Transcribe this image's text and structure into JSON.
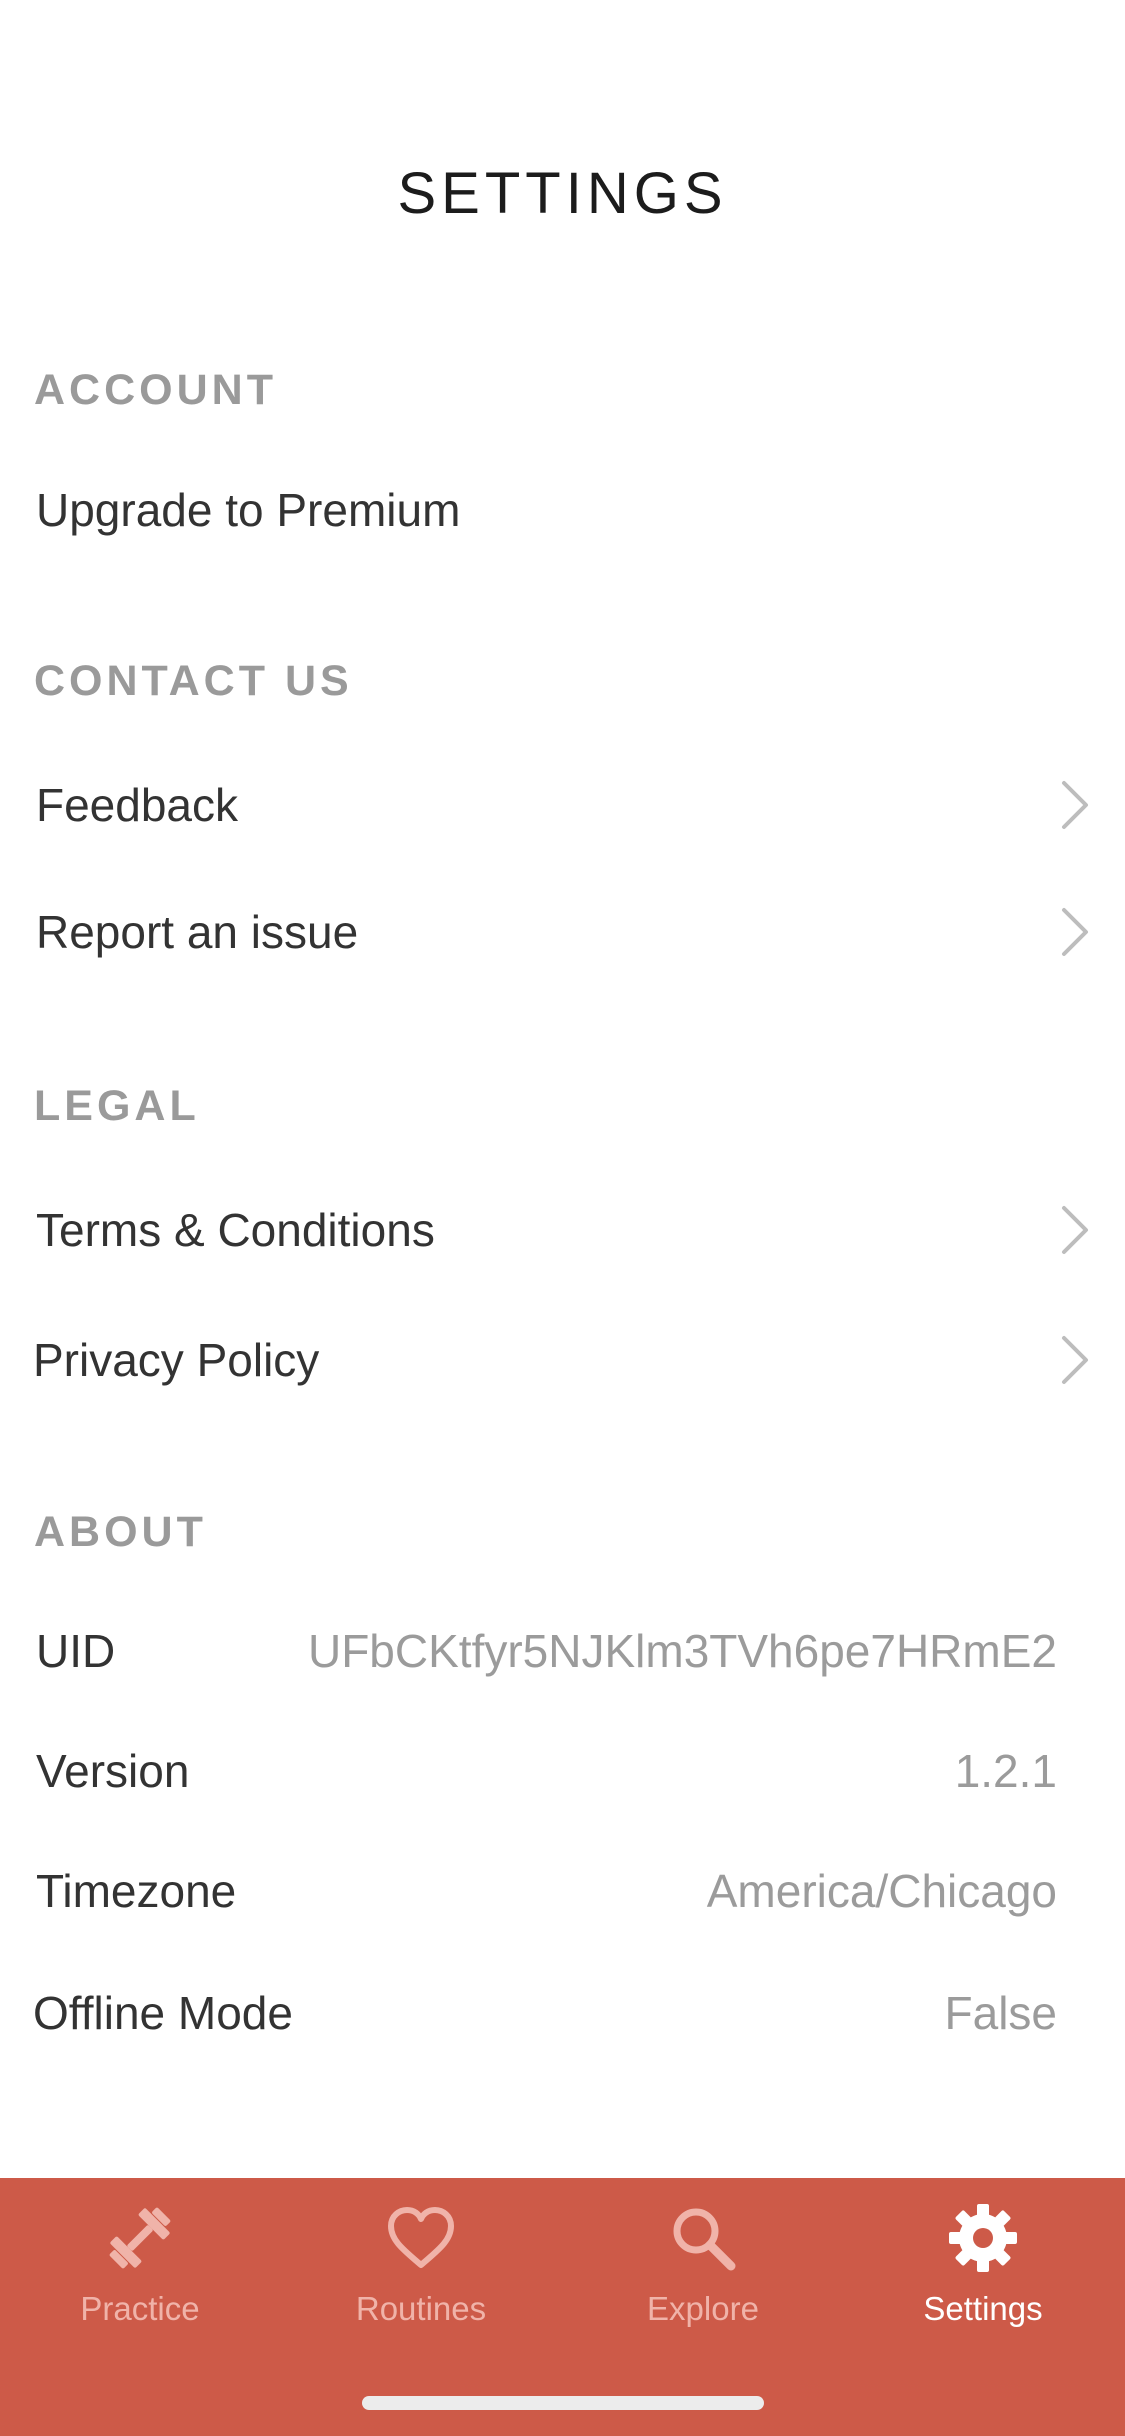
{
  "header": {
    "title": "SETTINGS"
  },
  "sections": {
    "account": {
      "title": "ACCOUNT",
      "items": [
        {
          "label": "Upgrade to Premium"
        }
      ]
    },
    "contact": {
      "title": "CONTACT US",
      "items": [
        {
          "label": "Feedback"
        },
        {
          "label": "Report an issue"
        }
      ]
    },
    "legal": {
      "title": "LEGAL",
      "items": [
        {
          "label": "Terms & Conditions"
        },
        {
          "label": "Privacy Policy"
        }
      ]
    },
    "about": {
      "title": "ABOUT",
      "items": [
        {
          "label": "UID",
          "value": "UFbCKtfyr5NJKlm3TVh6pe7HRmE2"
        },
        {
          "label": "Version",
          "value": "1.2.1"
        },
        {
          "label": "Timezone",
          "value": "America/Chicago"
        },
        {
          "label": "Offline Mode",
          "value": "False"
        }
      ]
    }
  },
  "tabbar": {
    "tabs": [
      {
        "label": "Practice",
        "icon": "dumbbell-icon",
        "active": false
      },
      {
        "label": "Routines",
        "icon": "heart-icon",
        "active": false
      },
      {
        "label": "Explore",
        "icon": "search-icon",
        "active": false
      },
      {
        "label": "Settings",
        "icon": "gear-icon",
        "active": true
      }
    ]
  },
  "colors": {
    "accent": "#cd5a48",
    "inactive_tab": "#f0b3a9",
    "section_header": "#9a9a9a",
    "value_text": "#9b9b9b"
  }
}
